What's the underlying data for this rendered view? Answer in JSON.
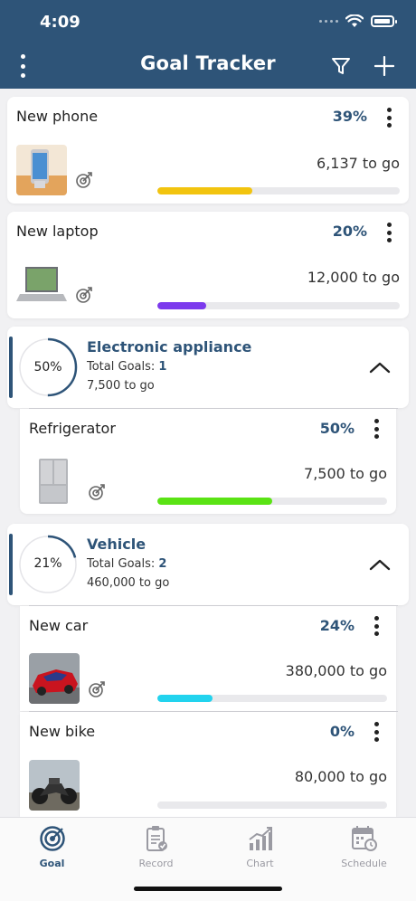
{
  "status_bar": {
    "time": "4:09"
  },
  "header": {
    "title": "Goal Tracker"
  },
  "goals": [
    {
      "name": "New phone",
      "percent": "39%",
      "remaining": "6,137 to go",
      "progress": 0.39,
      "color": "#f2c40f"
    },
    {
      "name": "New laptop",
      "percent": "20%",
      "remaining": "12,000 to go",
      "progress": 0.2,
      "color": "#7c3aed"
    }
  ],
  "groups": [
    {
      "name": "Electronic appliance",
      "ring_label": "50%",
      "ring_progress": 0.5,
      "total_goals_label": "Total Goals:",
      "total_goals": "1",
      "remaining": "7,500 to go",
      "items": [
        {
          "name": "Refrigerator",
          "percent": "50%",
          "remaining": "7,500 to go",
          "progress": 0.5,
          "color": "#5ae314"
        }
      ]
    },
    {
      "name": "Vehicle",
      "ring_label": "21%",
      "ring_progress": 0.21,
      "total_goals_label": "Total Goals:",
      "total_goals": "2",
      "remaining": "460,000 to go",
      "items": [
        {
          "name": "New car",
          "percent": "24%",
          "remaining": "380,000 to go",
          "progress": 0.24,
          "color": "#22d3ee"
        },
        {
          "name": "New bike",
          "percent": "0%",
          "remaining": "80,000 to go",
          "progress": 0.0,
          "color": "#22d3ee"
        }
      ]
    }
  ],
  "tabs": [
    {
      "label": "Goal",
      "icon": "target-icon",
      "active": true
    },
    {
      "label": "Record",
      "icon": "clipboard-icon",
      "active": false
    },
    {
      "label": "Chart",
      "icon": "chart-icon",
      "active": false
    },
    {
      "label": "Schedule",
      "icon": "calendar-icon",
      "active": false
    }
  ],
  "colors": {
    "primary": "#2e5478",
    "background": "#f1f1f3"
  }
}
